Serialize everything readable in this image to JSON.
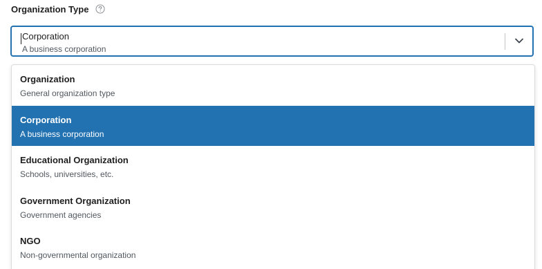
{
  "field": {
    "label": "Organization Type",
    "help_icon": "question-circle-icon"
  },
  "select": {
    "value_title": "Corporation",
    "value_description": "A business corporation",
    "toggle_icon": "chevron-down-icon"
  },
  "options": [
    {
      "title": "Organization",
      "description": "General organization type",
      "selected": false
    },
    {
      "title": "Corporation",
      "description": "A business corporation",
      "selected": true
    },
    {
      "title": "Educational Organization",
      "description": "Schools, universities, etc.",
      "selected": false
    },
    {
      "title": "Government Organization",
      "description": "Government agencies",
      "selected": false
    },
    {
      "title": "NGO",
      "description": "Non-governmental organization",
      "selected": false
    }
  ],
  "colors": {
    "accent": "#2271b1",
    "text": "#1e1e1e",
    "muted": "#50575e"
  }
}
